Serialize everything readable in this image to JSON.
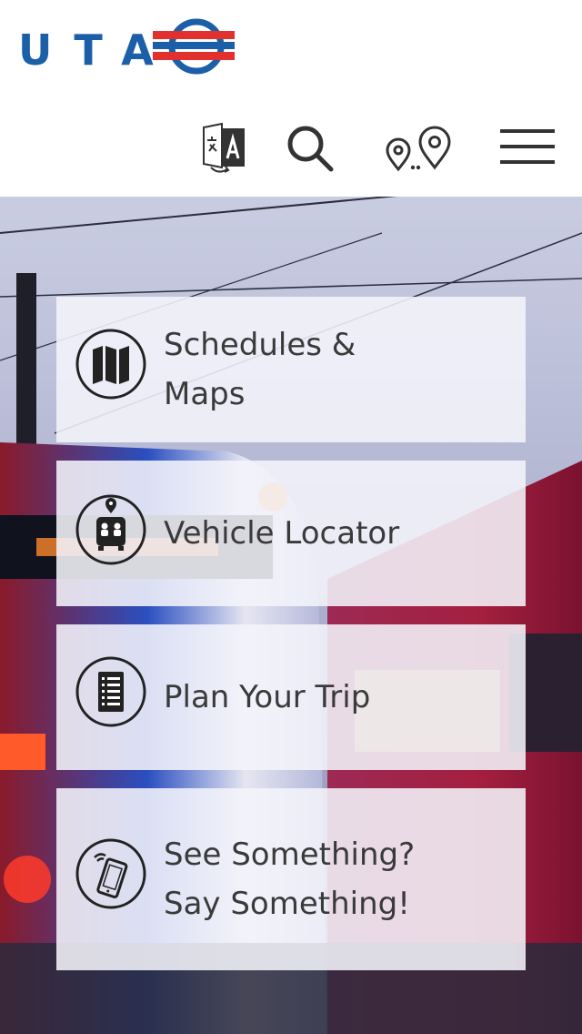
{
  "header": {
    "logo_text": "UTA",
    "icons": {
      "translate": "translate-icon",
      "search": "search-icon",
      "trip": "trip-planner-pins-icon",
      "menu": "hamburger-menu-icon"
    }
  },
  "colors": {
    "brand_blue": "#1b5fa8",
    "brand_red": "#e1302e",
    "icon_dark": "#333333",
    "tile_bg": "rgba(244,244,250,0.88)"
  },
  "tiles": [
    {
      "label": "Schedules &\nMaps",
      "icon": "map-icon"
    },
    {
      "label": "Vehicle Locator",
      "icon": "bus-locator-icon"
    },
    {
      "label": "Plan Your Trip",
      "icon": "trip-list-icon"
    },
    {
      "label": "See Something?\nSay Something!",
      "icon": "phone-signal-icon"
    }
  ]
}
